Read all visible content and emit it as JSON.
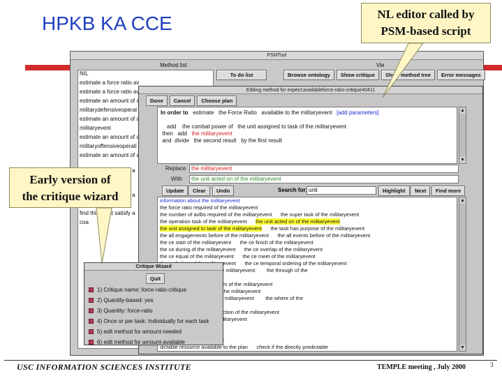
{
  "slide": {
    "title": "HPKB KA CCE",
    "footer_left": "USC INFORMATION SCIENCES INSTITUTE",
    "footer_right": "TEMPLE meeting , July 2000",
    "page_number": "3",
    "accent_color": "#d22a2a",
    "title_color": "#1f3fbf"
  },
  "callouts": {
    "nl_editor": [
      "NL editor called by",
      "PSM-based script"
    ],
    "wizard": [
      "Early version of",
      "the critique wizard"
    ]
  },
  "psm": {
    "window_title": "PSMTool",
    "method_list_label": "Method list",
    "view_label": "Vie",
    "todo_button": "To do list",
    "buttons": [
      "Browse ontology",
      "Show critique",
      "Show method tree",
      "Error messages"
    ],
    "methods": [
      "NIL",
      "estimate a force ratio av",
      "estimate a force ratio av",
      "estimate an amount of a",
      "militarydefensiveoperat",
      "estimate an amount of a",
      "militaryevent",
      "estimate an amount of a",
      "militaryoffensiveoperati",
      "estimate an amount of a",
      "",
      "find thing that satisfy a",
      "in",
      "",
      "find thing that satisfy a",
      "critique a coa",
      "find thing that satisfy a",
      "coa"
    ]
  },
  "editor": {
    "title": "Editing method for expect:availableforce-ratio-critique40411",
    "toolbar": [
      "Done",
      "Cancel",
      "Choose plan"
    ],
    "method_text": {
      "in_order_to": "In order to",
      "estimate": "estimate",
      "the_force_ratio": "the Force Ratio",
      "available_to": "available to the militaryevent",
      "add_params": "[add parameters]",
      "line2": "add    the combat power of   the unit assigned to task of the militaryevent",
      "line3_prefix": "then   add",
      "line3_red": "the militaryevent",
      "line4": "and  divide   the second result   by the first result"
    },
    "replace_label": "Replace",
    "replace_value": "the militaryevent",
    "with_label": "With",
    "with_value": "the unit acted on of the militaryevent",
    "buttons": [
      "Update",
      "Clear",
      "Undo"
    ],
    "search_label": "Search for:",
    "search_value": "unit",
    "search_buttons": [
      "Highlight",
      "Next",
      "Find more"
    ],
    "info_header": "information about the militaryevent",
    "info_lines": [
      {
        "a": "the force ratio required of the militaryevent",
        "b": ""
      },
      {
        "a": "the number of avlbs required of the militaryevent",
        "b": "the super task of the militaryevent"
      },
      {
        "a": "the operation task of the militaryevent",
        "b": "the unit acted on of the militaryevent",
        "hl_b": true
      },
      {
        "a": "the unit assigned to task of the militaryevent",
        "b": "the task has purpose of the militaryevent",
        "hl_a": true
      },
      {
        "a": "the all engagements before of the militaryevent",
        "b": "the all events before of the militaryevent"
      },
      {
        "a": "the ce start of the militaryevent",
        "b": "the ce finish of the militaryevent"
      },
      {
        "a": "the ce during of the militaryevent",
        "b": "the ce overlap of the militaryevent"
      },
      {
        "a": "the ce equal of the militaryevent",
        "b": "the ce meet of the militaryevent"
      },
      {
        "a": "the ce before of the militaryevent",
        "b": "the ce temporal ordering of the militaryevent"
      },
      {
        "a": "yevent",
        "b": "the against of the militaryevent        the through of the"
      },
      {
        "a": "",
        "b": ""
      },
      {
        "a": "litaryevent",
        "b": "the action from of the militaryevent"
      },
      {
        "a": "yevent",
        "b": "the action obj of the militaryevent"
      },
      {
        "a": "tryevent",
        "b": "the when of the militaryevent        the where of the"
      },
      {
        "a": "",
        "b": ""
      },
      {
        "a": "ent",
        "b": "the orgAssignedToAction of the militaryevent"
      },
      {
        "a": "AssignedToAction of the militaryevent",
        "b": ""
      },
      {
        "a": "",
        "b": ""
      },
      {
        "a": "",
        "b": ""
      },
      {
        "a": "d the number to the number",
        "b": ""
      },
      {
        "a": "dictable resource available to the plan",
        "b": "check if the directly predictable"
      }
    ]
  },
  "wizard": {
    "title": "Critique Wizard",
    "quit": "Quit",
    "items": [
      "1) Critique name: force-ratio-critique",
      "2) Quantity-based: yes",
      "3) Quantity: force-ratio",
      "4) Once or per task: Individually for each task",
      "5) edit method for amount-needed",
      "6) edit method for amount-available"
    ]
  }
}
